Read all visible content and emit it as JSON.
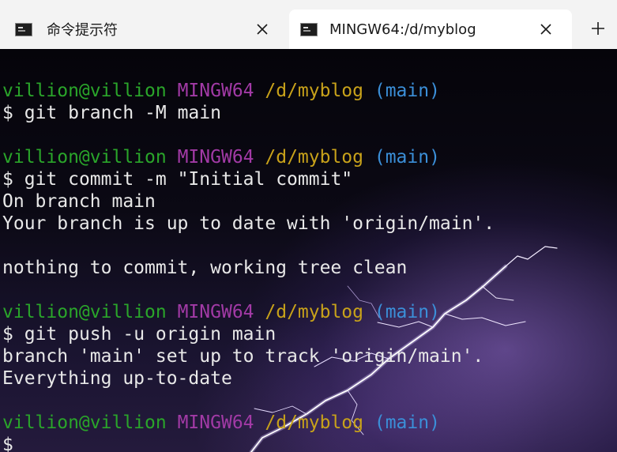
{
  "tabs": [
    {
      "title": "命令提示符",
      "icon": "cmd-terminal-icon",
      "active": false
    },
    {
      "title": "MINGW64:/d/myblog",
      "icon": "cmd-terminal-icon",
      "active": true
    }
  ],
  "prompt": {
    "user": "villion@villion",
    "system": "MINGW64",
    "path": "/d/myblog",
    "branch": "(main)",
    "symbol": "$"
  },
  "output": [
    {
      "type": "prompt"
    },
    {
      "type": "command",
      "text": "git branch -M main"
    },
    {
      "type": "blank"
    },
    {
      "type": "prompt"
    },
    {
      "type": "command",
      "text": "git commit -m \"Initial commit\""
    },
    {
      "type": "text",
      "text": "On branch main"
    },
    {
      "type": "text",
      "text": "Your branch is up to date with 'origin/main'."
    },
    {
      "type": "blank"
    },
    {
      "type": "text",
      "text": "nothing to commit, working tree clean"
    },
    {
      "type": "blank"
    },
    {
      "type": "prompt"
    },
    {
      "type": "command",
      "text": "git push -u origin main"
    },
    {
      "type": "text",
      "text": "branch 'main' set up to track 'origin/main'."
    },
    {
      "type": "text",
      "text": "Everything up-to-date"
    },
    {
      "type": "blank"
    },
    {
      "type": "prompt"
    },
    {
      "type": "command",
      "text": ""
    }
  ],
  "colors": {
    "user": "#2aa52a",
    "system": "#a23aa6",
    "path": "#c8a21a",
    "branch": "#3b8fd8",
    "text": "#e8e8e8"
  }
}
